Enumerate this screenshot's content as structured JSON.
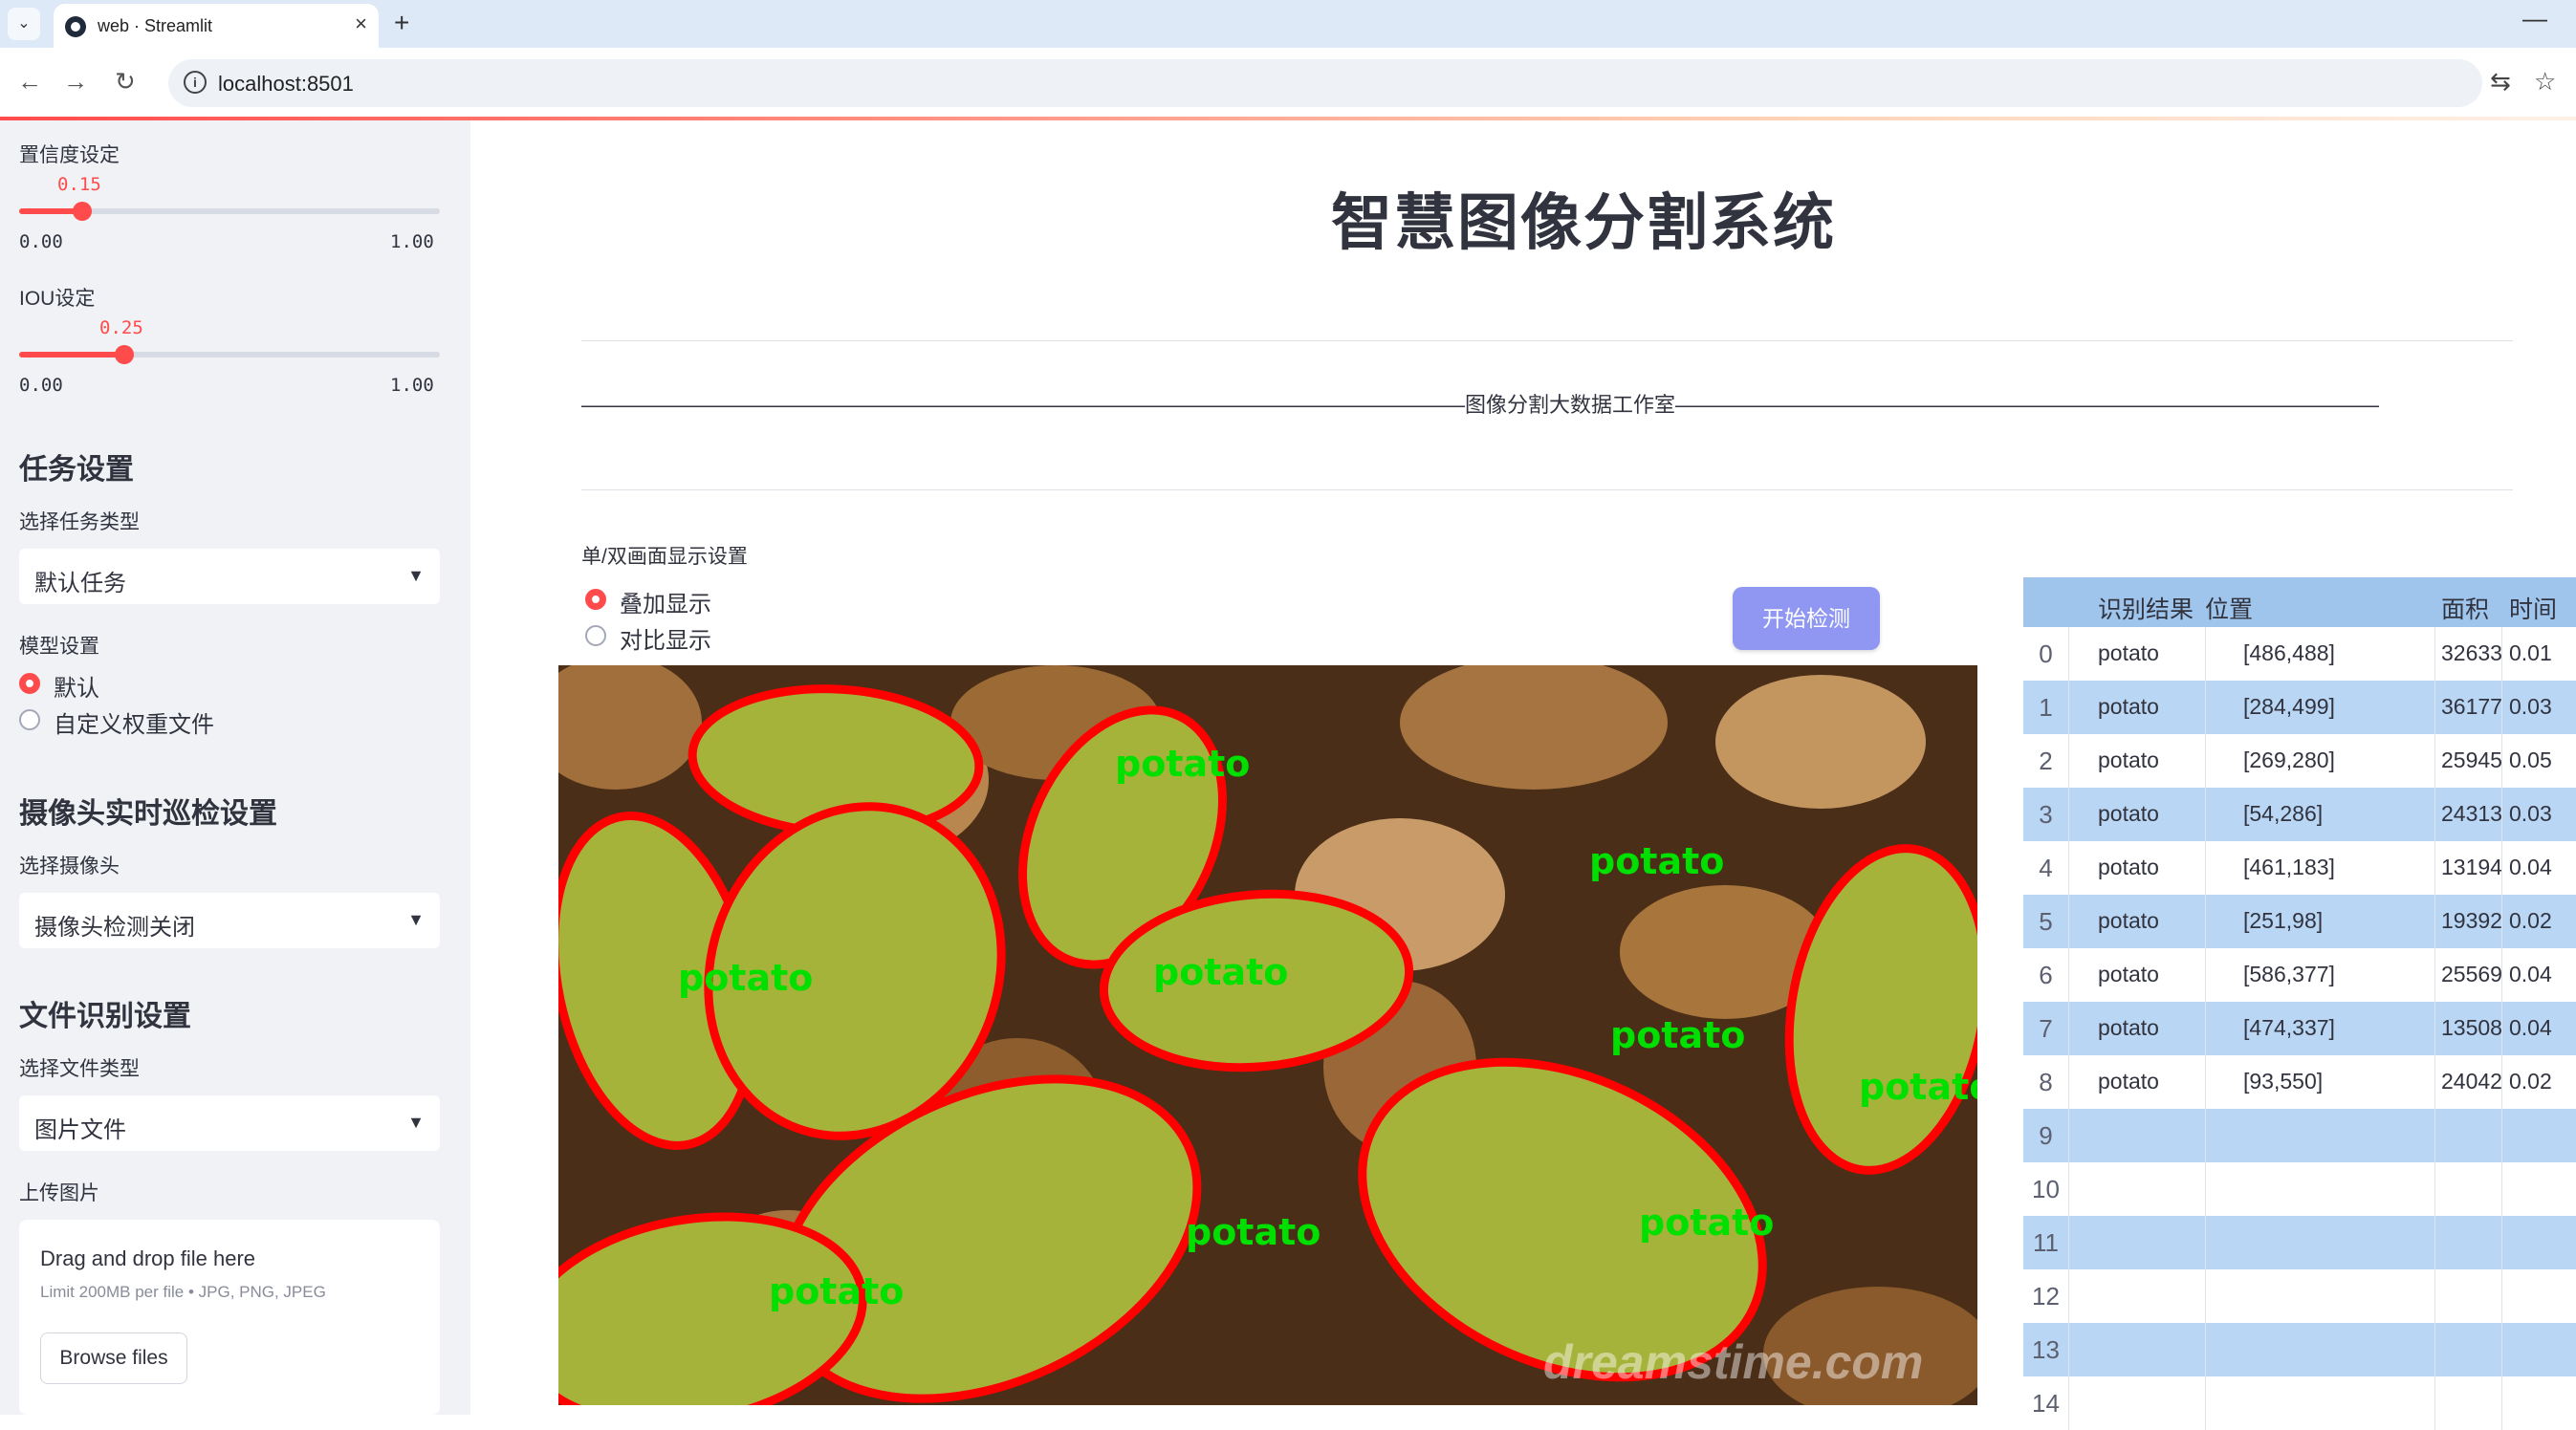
{
  "browser": {
    "tab_title": "web · Streamlit",
    "url": "localhost:8501",
    "new_tab": "+",
    "close": "×",
    "minimize": "—"
  },
  "sidebar": {
    "confidence": {
      "label": "置信度设定",
      "value": "0.15",
      "value_fraction": 0.15,
      "min": "0.00",
      "max": "1.00"
    },
    "iou": {
      "label": "IOU设定",
      "value": "0.25",
      "value_fraction": 0.25,
      "min": "0.00",
      "max": "1.00"
    },
    "task_header": "任务设置",
    "task_type_label": "选择任务类型",
    "task_type_value": "默认任务",
    "model_label": "模型设置",
    "model_options": [
      "默认",
      "自定义权重文件"
    ],
    "model_selected": 0,
    "camera_header": "摄像头实时巡检设置",
    "camera_label": "选择摄像头",
    "camera_value": "摄像头检测关闭",
    "file_header": "文件识别设置",
    "file_type_label": "选择文件类型",
    "file_type_value": "图片文件",
    "upload_label": "上传图片",
    "upload_title": "Drag and drop file here",
    "upload_limit": "Limit 200MB per file • JPG, PNG, JPEG",
    "browse_label": "Browse files"
  },
  "main": {
    "title": "智慧图像分割系统",
    "subtitle": "——————————————————————————————————————————图像分割大数据工作室——————————————————————————————————————————",
    "display_label": "单/双画面显示设置",
    "display_options": [
      "叠加显示",
      "对比显示"
    ],
    "display_selected": 0,
    "detect_button": "开始检测",
    "image_label": "potato",
    "watermark": "dreamstime.com"
  },
  "results_table": {
    "columns": [
      "识别结果",
      "位置",
      "面积",
      "时间"
    ],
    "rows": [
      {
        "idx": "0",
        "label": "potato",
        "pos": "[486,488]",
        "area": "32633",
        "time": "0.01"
      },
      {
        "idx": "1",
        "label": "potato",
        "pos": "[284,499]",
        "area": "36177",
        "time": "0.03"
      },
      {
        "idx": "2",
        "label": "potato",
        "pos": "[269,280]",
        "area": "25945",
        "time": "0.05"
      },
      {
        "idx": "3",
        "label": "potato",
        "pos": "[54,286]",
        "area": "24313",
        "time": "0.03"
      },
      {
        "idx": "4",
        "label": "potato",
        "pos": "[461,183]",
        "area": "13194",
        "time": "0.04"
      },
      {
        "idx": "5",
        "label": "potato",
        "pos": "[251,98]",
        "area": "19392",
        "time": "0.02"
      },
      {
        "idx": "6",
        "label": "potato",
        "pos": "[586,377]",
        "area": "25569",
        "time": "0.04"
      },
      {
        "idx": "7",
        "label": "potato",
        "pos": "[474,337]",
        "area": "13508",
        "time": "0.04"
      },
      {
        "idx": "8",
        "label": "potato",
        "pos": "[93,550]",
        "area": "24042",
        "time": "0.02"
      },
      {
        "idx": "9",
        "label": "",
        "pos": "",
        "area": "",
        "time": ""
      },
      {
        "idx": "10",
        "label": "",
        "pos": "",
        "area": "",
        "time": ""
      },
      {
        "idx": "11",
        "label": "",
        "pos": "",
        "area": "",
        "time": ""
      },
      {
        "idx": "12",
        "label": "",
        "pos": "",
        "area": "",
        "time": ""
      },
      {
        "idx": "13",
        "label": "",
        "pos": "",
        "area": "",
        "time": ""
      },
      {
        "idx": "14",
        "label": "",
        "pos": "",
        "area": "",
        "time": ""
      }
    ]
  },
  "colors": {
    "accent": "#ff4b4b",
    "button": "#8f97f2",
    "mask": "#a6b33a",
    "outline": "#ff0000",
    "label_text": "#00e000"
  }
}
